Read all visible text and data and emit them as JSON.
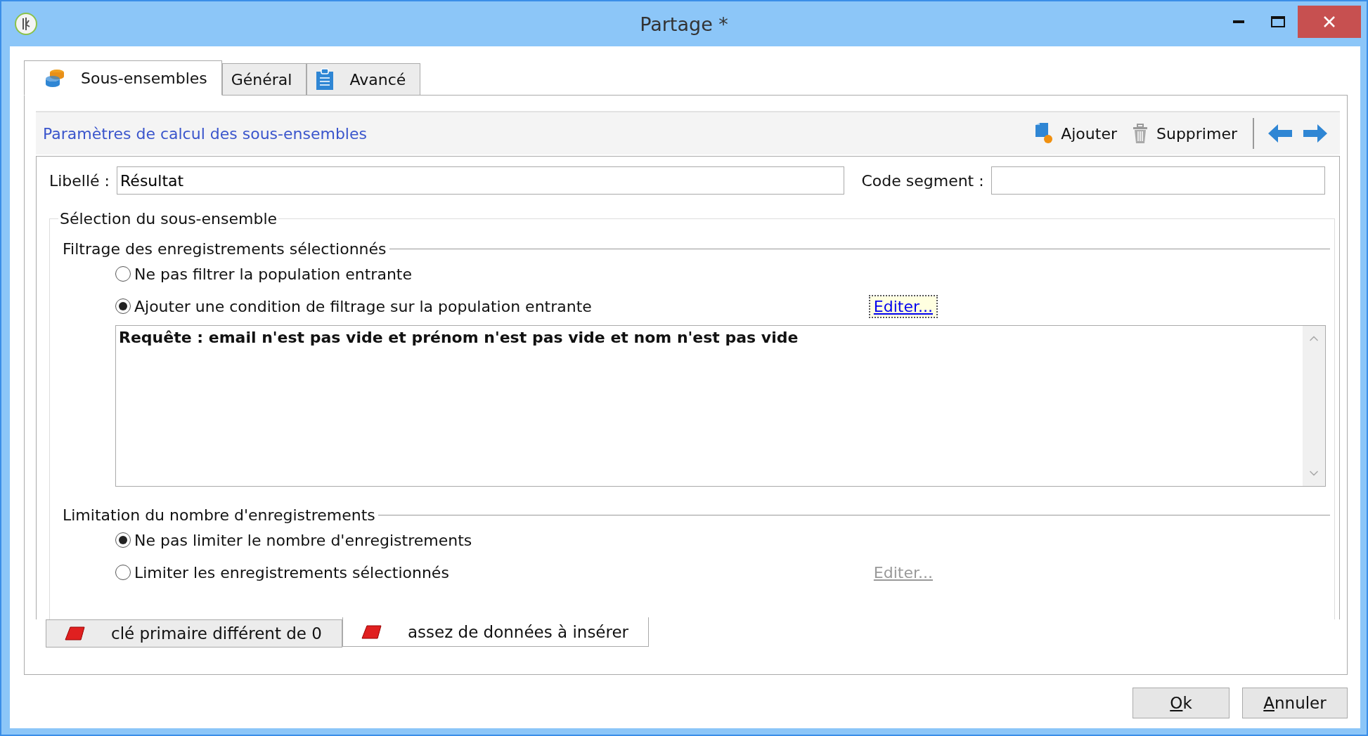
{
  "window": {
    "title": "Partage *"
  },
  "tabs": [
    {
      "label": "Sous-ensembles",
      "selected": true,
      "kind": "database"
    },
    {
      "label": "Général",
      "selected": false,
      "kind": "plain"
    },
    {
      "label": "Avancé",
      "selected": false,
      "kind": "clipboard"
    }
  ],
  "header": {
    "title": "Paramètres de calcul des sous-ensembles",
    "toolbar": [
      {
        "label": "Ajouter",
        "kind": "add"
      },
      {
        "label": "Supprimer",
        "kind": "delete"
      }
    ]
  },
  "fields": [
    {
      "label": "Libellé :",
      "value": "Résultat"
    },
    {
      "label": "Code segment :"
    }
  ],
  "selection": {
    "title": "Sélection du sous-ensemble",
    "filter": {
      "title": "Filtrage des enregistrements sélectionnés",
      "options": [
        {
          "label": "Ne pas filtrer la population entrante",
          "selected": false
        },
        {
          "label": "Ajouter une condition de filtrage sur la population entrante",
          "selected": true
        }
      ],
      "edit_link": {
        "label": "Editer...",
        "disabled": false,
        "focused": true
      },
      "query": "Requête : email n'est pas vide et prénom n'est pas vide et nom n'est pas vide"
    },
    "limit": {
      "title": "Limitation du nombre d'enregistrements",
      "options": [
        {
          "label": "Ne pas limiter le nombre d'enregistrements",
          "selected": true
        },
        {
          "label": "Limiter les enregistrements sélectionnés",
          "selected": false
        }
      ],
      "edit_link": {
        "label": "Editer...",
        "disabled": true,
        "focused": false
      }
    }
  },
  "subtabs": [
    {
      "label": "clé primaire différent de 0",
      "selected": false
    },
    {
      "label": "assez de données à insérer",
      "selected": true
    }
  ],
  "buttons": [
    "Ok",
    "Annuler"
  ]
}
